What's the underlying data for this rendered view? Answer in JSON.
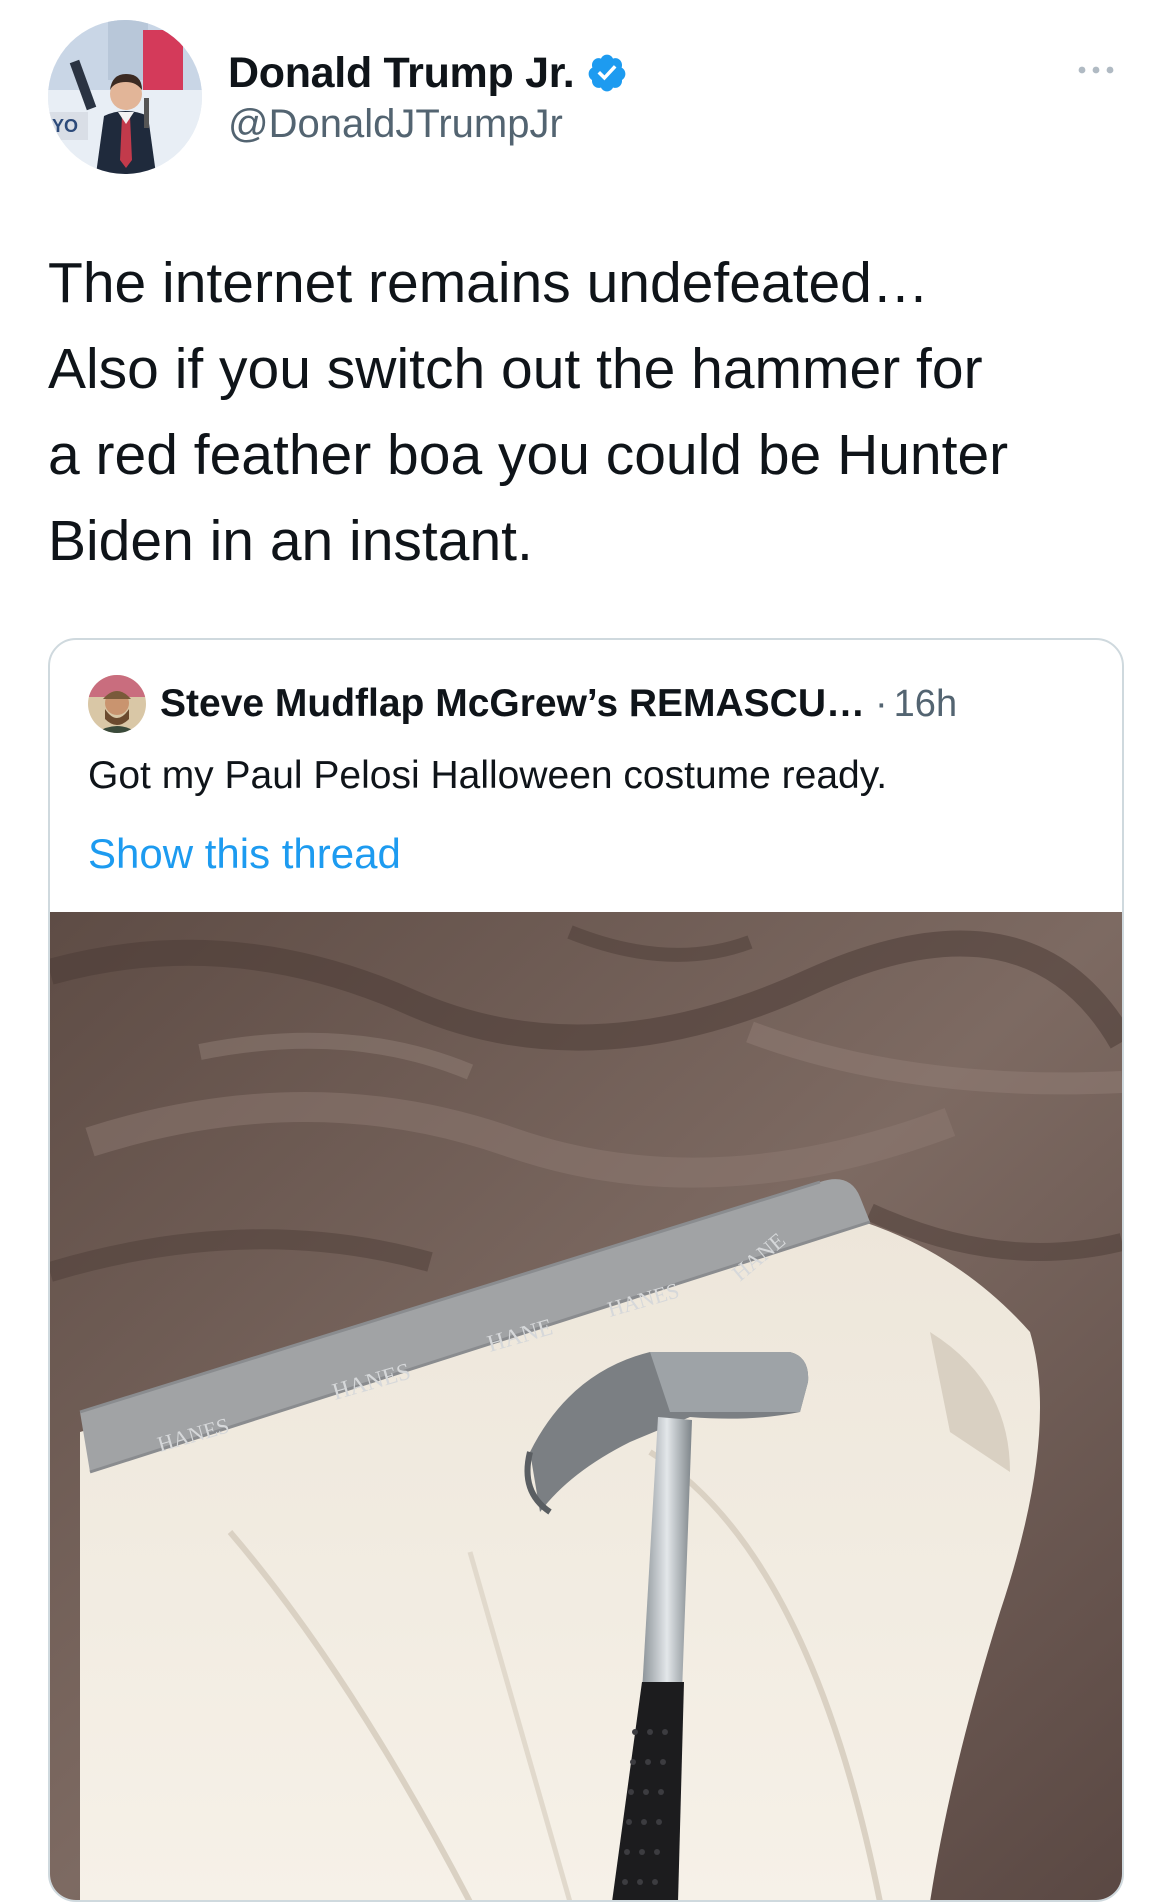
{
  "tweet": {
    "author": {
      "display_name": "Donald Trump Jr.",
      "handle": "@DonaldJTrumpJr"
    },
    "text": "The internet remains undefeated…\nAlso if you switch out the hammer for\na red feather boa you could be Hunter\nBiden in an instant.",
    "more_icon": "more-icon"
  },
  "quoted": {
    "author": "Steve Mudflap McGrew’s REMASCU…",
    "separator": "·",
    "time": "16h",
    "text": "Got my Paul Pelosi Halloween costume ready.",
    "show_thread": "Show this thread",
    "photo_labels": [
      "HANES",
      "HANES",
      "HANE",
      "HANES",
      "HANE"
    ]
  },
  "colors": {
    "link": "#1d9bf0",
    "verified": "#1d9bf0",
    "secondary": "#536471",
    "border": "#cfd9de"
  }
}
